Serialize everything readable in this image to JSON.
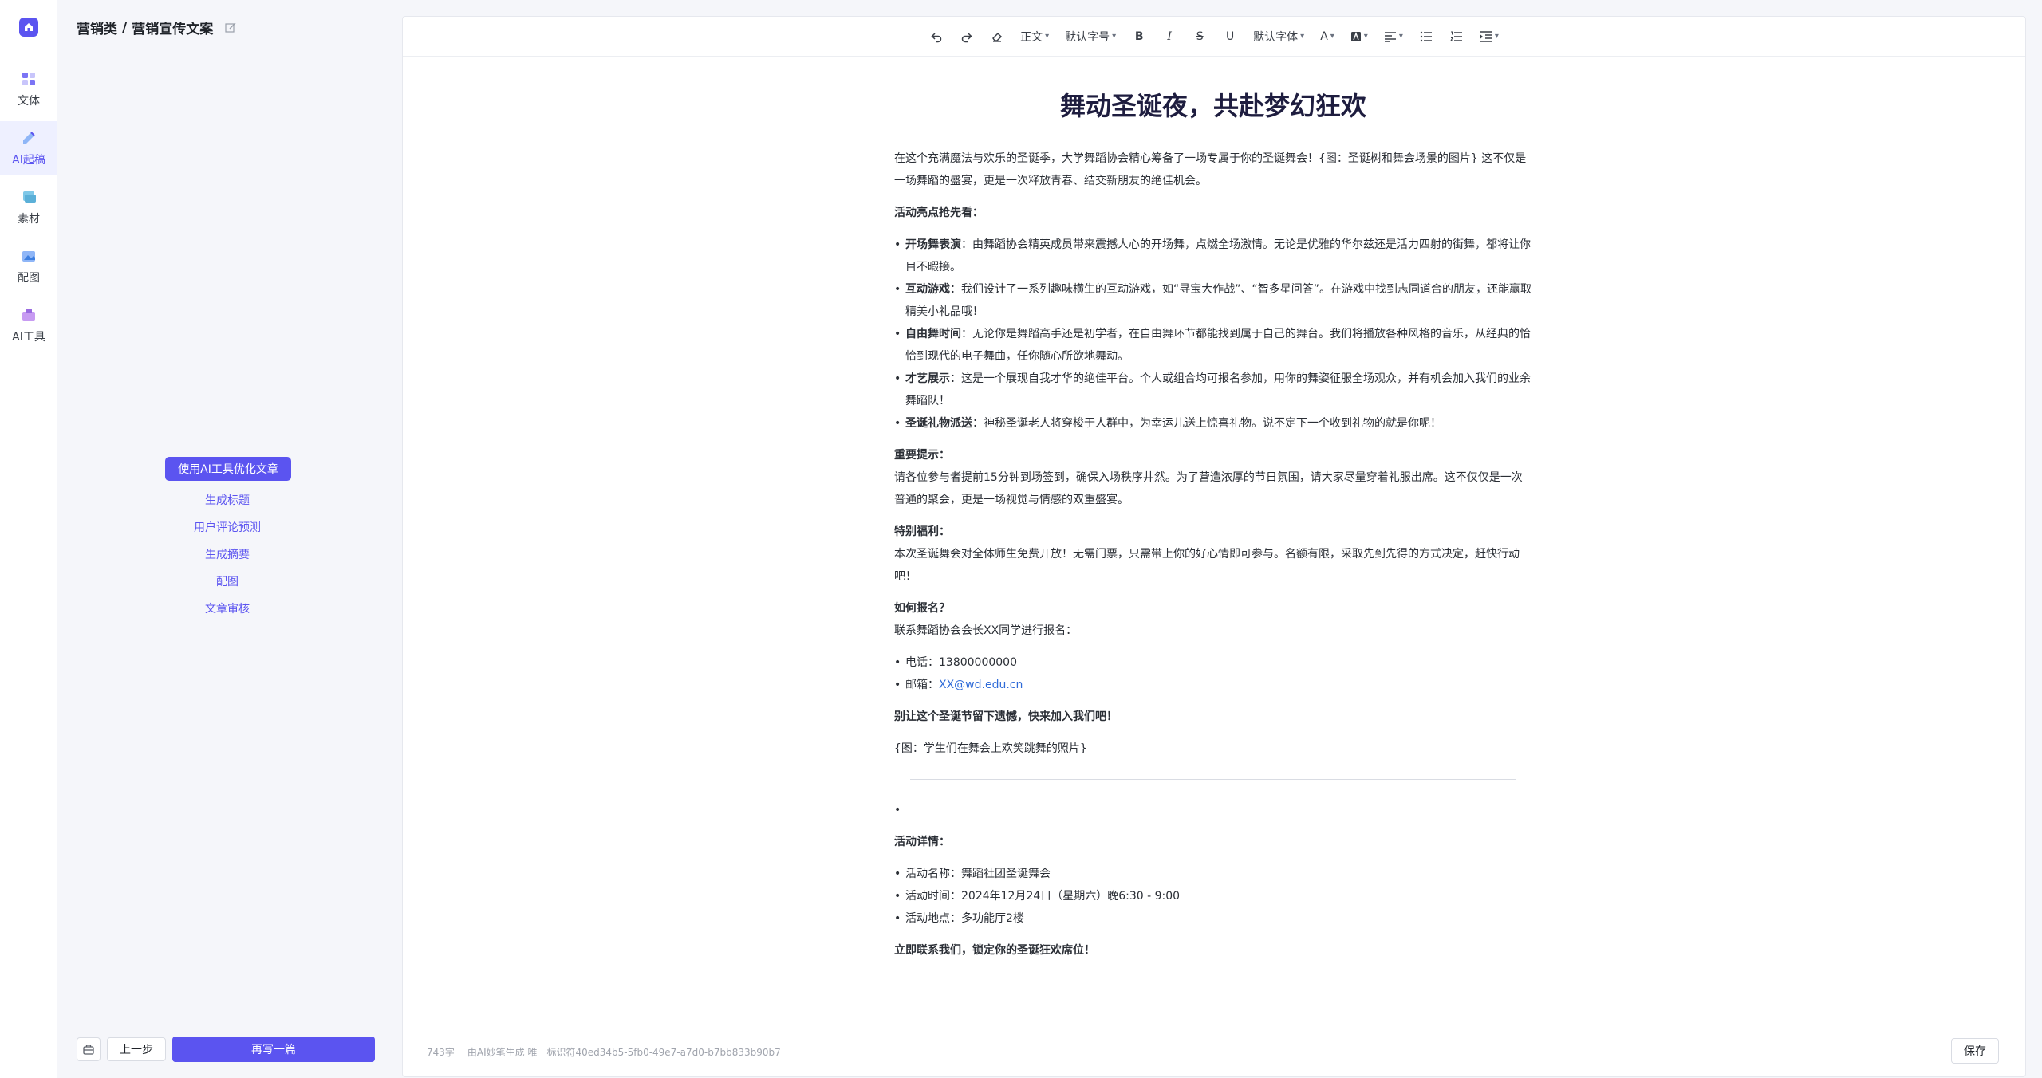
{
  "nav": {
    "items": [
      {
        "label": "文体",
        "icon": "text-style-icon"
      },
      {
        "label": "AI起稿",
        "icon": "ai-draft-icon"
      },
      {
        "label": "素材",
        "icon": "material-icon"
      },
      {
        "label": "配图",
        "icon": "image-icon"
      },
      {
        "label": "AI工具",
        "icon": "ai-tools-icon"
      }
    ],
    "active_index": 1
  },
  "breadcrumb": {
    "category": "营销类",
    "separator": "/",
    "page": "营销宣传文案"
  },
  "ai_tools": {
    "primary_label": "使用AI工具优化文章",
    "links": [
      "生成标题",
      "用户评论预测",
      "生成摘要",
      "配图",
      "文章审核"
    ]
  },
  "bottom": {
    "prev_label": "上一步",
    "rewrite_label": "再写一篇"
  },
  "toolbar": {
    "paragraph": "正文",
    "font_size": "默认字号",
    "font_family": "默认字体",
    "text_color_glyph": "A"
  },
  "doc": {
    "title": "舞动圣诞夜，共赴梦幻狂欢",
    "intro": "在这个充满魔法与欢乐的圣诞季，大学舞蹈协会精心筹备了一场专属于你的圣诞舞会！{图：圣诞树和舞会场景的图片} 这不仅是一场舞蹈的盛宴，更是一次释放青春、结交新朋友的绝佳机会。",
    "highlights_heading": "活动亮点抢先看：",
    "highlights": [
      {
        "k": "开场舞表演",
        "v": "：由舞蹈协会精英成员带来震撼人心的开场舞，点燃全场激情。无论是优雅的华尔兹还是活力四射的街舞，都将让你目不暇接。"
      },
      {
        "k": "互动游戏",
        "v": "：我们设计了一系列趣味横生的互动游戏，如“寻宝大作战”、“智多星问答”。在游戏中找到志同道合的朋友，还能赢取精美小礼品哦！"
      },
      {
        "k": "自由舞时间",
        "v": "：无论你是舞蹈高手还是初学者，在自由舞环节都能找到属于自己的舞台。我们将播放各种风格的音乐，从经典的恰恰到现代的电子舞曲，任你随心所欲地舞动。"
      },
      {
        "k": "才艺展示",
        "v": "：这是一个展现自我才华的绝佳平台。个人或组合均可报名参加，用你的舞姿征服全场观众，并有机会加入我们的业余舞蹈队！"
      },
      {
        "k": "圣诞礼物派送",
        "v": "：神秘圣诞老人将穿梭于人群中，为幸运儿送上惊喜礼物。说不定下一个收到礼物的就是你呢！"
      }
    ],
    "tips_heading": "重要提示：",
    "tips": "请各位参与者提前15分钟到场签到，确保入场秩序井然。为了营造浓厚的节日氛围，请大家尽量穿着礼服出席。这不仅仅是一次普通的聚会，更是一场视觉与情感的双重盛宴。",
    "benefit_heading": "特别福利：",
    "benefit": "本次圣诞舞会对全体师生免费开放！无需门票，只需带上你的好心情即可参与。名额有限，采取先到先得的方式决定，赶快行动吧！",
    "signup_heading": "如何报名？",
    "signup": "联系舞蹈协会会长XX同学进行报名：",
    "phone_label": "电话：",
    "phone": "13800000000",
    "email_label": "邮箱：",
    "email": "XX@wd.edu.cn",
    "call_to_action": "别让这个圣诞节留下遗憾，快来加入我们吧！",
    "photo_note": "{图：学生们在舞会上欢笑跳舞的照片}",
    "details_heading": "活动详情：",
    "details": [
      "活动名称：舞蹈社团圣诞舞会",
      "活动时间：2024年12月24日（星期六）晚6:30 - 9:00",
      "活动地点：多功能厅2楼"
    ],
    "closing": "立即联系我们，锁定你的圣诞狂欢席位！"
  },
  "footer": {
    "word_count": "743字",
    "generated_by": "由AI妙笔生成 唯一标识符40ed34b5-5fb0-49e7-a7d0-b7bb833b90b7",
    "save_label": "保存"
  },
  "colors": {
    "accent": "#5b54f0",
    "link": "#2f6bd8",
    "title": "#1e1d3f"
  }
}
